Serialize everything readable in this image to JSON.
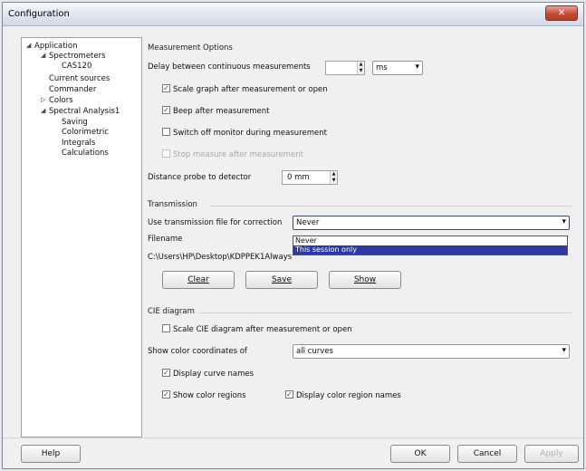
{
  "window": {
    "title": "Configuration"
  },
  "tree": {
    "items": [
      {
        "label": "Application",
        "level": 0,
        "twisty": "◢"
      },
      {
        "label": "Spectrometers",
        "level": 1,
        "twisty": "◢"
      },
      {
        "label": "CAS120",
        "level": 2,
        "twisty": ""
      },
      {
        "label": "Current sources",
        "level": 1,
        "twisty": ""
      },
      {
        "label": "Commander",
        "level": 1,
        "twisty": ""
      },
      {
        "label": "Colors",
        "level": 1,
        "twisty": "▷"
      },
      {
        "label": "Spectral Analysis1",
        "level": 1,
        "twisty": "◢"
      },
      {
        "label": "Saving",
        "level": 2,
        "twisty": ""
      },
      {
        "label": "Colorimetric",
        "level": 2,
        "twisty": ""
      },
      {
        "label": "Integrals",
        "level": 2,
        "twisty": ""
      },
      {
        "label": "Calculations",
        "level": 2,
        "twisty": ""
      }
    ]
  },
  "measurement": {
    "section_title": "Measurement Options",
    "delay_label": "Delay between continuous measurements",
    "delay_unit": "ms",
    "scale_graph": {
      "label": "Scale graph after measurement or open",
      "checked": "✓"
    },
    "beep": {
      "label": "Beep after measurement",
      "checked": "✓"
    },
    "switch_off": {
      "label": "Switch off monitor during measurement",
      "checked": ""
    },
    "disabled_option": {
      "label": "Stop measure after measurement",
      "checked": ""
    },
    "distance_label": "Distance probe to detector",
    "distance_value": "0 mm"
  },
  "transmission": {
    "section_title": "Transmission",
    "use_file_label": "Use transmission file for correction",
    "selected": "Never",
    "options": [
      "Never",
      "This session only",
      "Always"
    ],
    "filename_label": "Filename",
    "filename_value": "C:\\Users\\HP\\Desktop\\KDPPEK1",
    "clear_label": "Clear",
    "save_label": "Save",
    "show_label": "Show"
  },
  "cie": {
    "section_title": "CIE diagram",
    "scale_cie": {
      "label": "Scale CIE diagram after measurement or open",
      "checked": ""
    },
    "show_coords_label": "Show color coordinates of",
    "show_coords_value": "all curves",
    "display_curve_names": {
      "label": "Display curve names",
      "checked": "✓"
    },
    "show_color_regions": {
      "label": "Show color regions",
      "checked": "✓"
    },
    "display_region_names": {
      "label": "Display color region names",
      "checked": "✓"
    }
  },
  "footer": {
    "help_label": "Help",
    "ok_label": "OK",
    "cancel_label": "Cancel",
    "apply_label": "Apply"
  }
}
